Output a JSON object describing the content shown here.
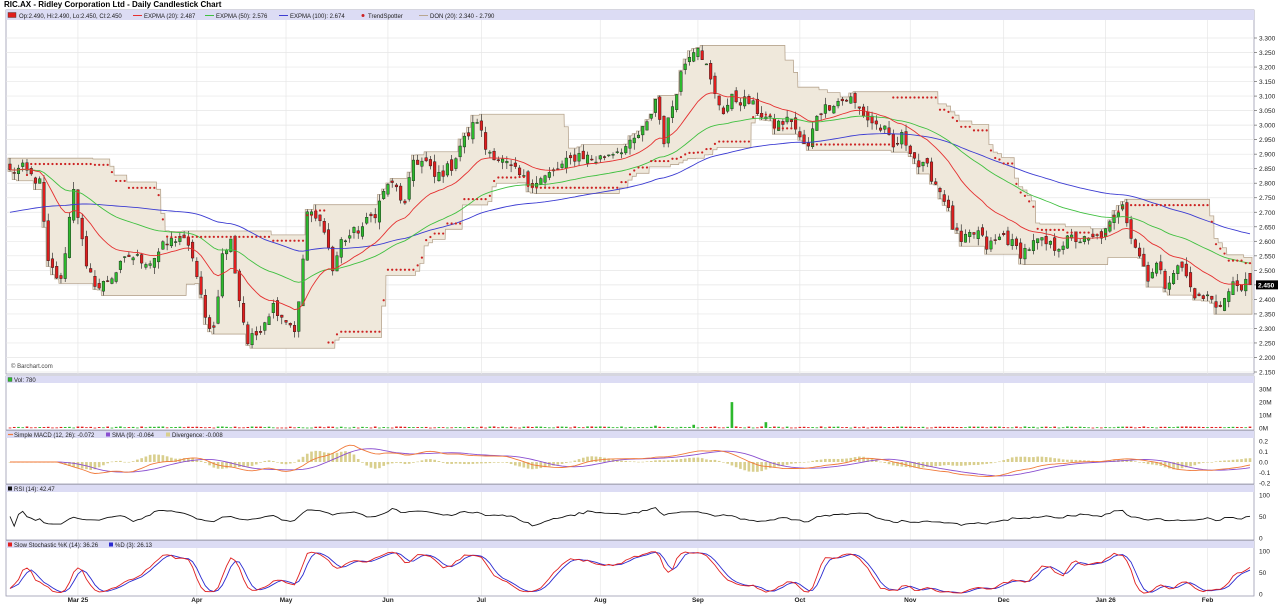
{
  "title": "RIC.AX - Ridley Corporation Ltd - Daily Candlestick Chart",
  "colors": {
    "up": "#2db92d",
    "down": "#e01e1e",
    "ema20": "#e53030",
    "ema50": "#40c040",
    "ema100": "#3c3cd2",
    "trend": "#cc2222",
    "don_fill": "#efe8db",
    "don_line": "#b8a690",
    "header_bg": "#dcdcf4",
    "grid": "#e6e6e6",
    "sma_line": "#8a4fd0",
    "macd_line": "#f07a3a",
    "hist": "#d9cf8e",
    "stoch_k": "#e02020",
    "stoch_d": "#2a2ad0"
  },
  "legend": {
    "ohlc": "Op:2.490, Hi:2.490, Lo:2.450, Cl:2.450",
    "ema20": "EXPMA (20): 2.487",
    "ema50": "EXPMA (50): 2.576",
    "ema100": "EXPMA (100): 2.674",
    "trend": "TrendSpotter",
    "don": "DON (20): 2.340 - 2.790"
  },
  "copyright": "© Barchart.com",
  "last_price": "2.450",
  "panels": {
    "volume": {
      "label": "Vol: 780",
      "ticks": [
        "30M",
        "20M",
        "10M",
        "0M"
      ]
    },
    "macd": {
      "label": "Simple MACD (12, 26): -0.072",
      "sma": "SMA (9): -0.064",
      "div": "Divergence: -0.008",
      "ticks": [
        "0.2",
        "0.1",
        "0.0",
        "-0.1",
        "-0.2"
      ]
    },
    "rsi": {
      "label": "RSI (14): 42.47",
      "ticks": [
        "100",
        "50",
        "0"
      ]
    },
    "stoch": {
      "label": "Slow Stochastic %K (14): 36.26",
      "d": "%D (3): 26.13",
      "ticks": [
        "100",
        "50",
        "0"
      ]
    }
  },
  "chart_data": {
    "type": "candlestick",
    "price_axis": {
      "min": 2.15,
      "max": 3.3,
      "ticks": [
        "3.300",
        "3.250",
        "3.200",
        "3.150",
        "3.100",
        "3.050",
        "3.000",
        "2.950",
        "2.900",
        "2.850",
        "2.800",
        "2.750",
        "2.700",
        "2.650",
        "2.600",
        "2.550",
        "2.500",
        "2.450",
        "2.400",
        "2.350",
        "2.300",
        "2.250",
        "2.200",
        "2.150"
      ]
    },
    "months": [
      "Mar 25",
      "Apr",
      "May",
      "Jun",
      "Jul",
      "Aug",
      "Sep",
      "Oct",
      "Nov",
      "Dec",
      "Jan 26",
      "Feb"
    ],
    "month_index": [
      16,
      44,
      65,
      89,
      111,
      139,
      162,
      186,
      212,
      234,
      258,
      282
    ],
    "anchors": [
      [
        0,
        2.84
      ],
      [
        3,
        2.85
      ],
      [
        7,
        2.8
      ],
      [
        9,
        2.52
      ],
      [
        12,
        2.46
      ],
      [
        15,
        2.79
      ],
      [
        18,
        2.5
      ],
      [
        21,
        2.44
      ],
      [
        24,
        2.48
      ],
      [
        28,
        2.55
      ],
      [
        33,
        2.53
      ],
      [
        36,
        2.58
      ],
      [
        40,
        2.62
      ],
      [
        43,
        2.55
      ],
      [
        46,
        2.33
      ],
      [
        48,
        2.3
      ],
      [
        50,
        2.55
      ],
      [
        52,
        2.6
      ],
      [
        54,
        2.4
      ],
      [
        56,
        2.25
      ],
      [
        58,
        2.28
      ],
      [
        62,
        2.38
      ],
      [
        65,
        2.33
      ],
      [
        67,
        2.3
      ],
      [
        68,
        2.38
      ],
      [
        70,
        2.7
      ],
      [
        74,
        2.65
      ],
      [
        76,
        2.5
      ],
      [
        78,
        2.6
      ],
      [
        80,
        2.62
      ],
      [
        83,
        2.65
      ],
      [
        86,
        2.7
      ],
      [
        89,
        2.8
      ],
      [
        91,
        2.78
      ],
      [
        93,
        2.72
      ],
      [
        95,
        2.88
      ],
      [
        98,
        2.87
      ],
      [
        100,
        2.82
      ],
      [
        104,
        2.86
      ],
      [
        106,
        2.93
      ],
      [
        108,
        2.97
      ],
      [
        110,
        3.02
      ],
      [
        112,
        2.92
      ],
      [
        114,
        2.9
      ],
      [
        118,
        2.85
      ],
      [
        122,
        2.8
      ],
      [
        126,
        2.82
      ],
      [
        130,
        2.86
      ],
      [
        134,
        2.9
      ],
      [
        138,
        2.88
      ],
      [
        142,
        2.91
      ],
      [
        146,
        2.93
      ],
      [
        150,
        3.0
      ],
      [
        152,
        3.09
      ],
      [
        154,
        2.95
      ],
      [
        156,
        3.07
      ],
      [
        158,
        3.18
      ],
      [
        160,
        3.25
      ],
      [
        162,
        3.28
      ],
      [
        164,
        3.2
      ],
      [
        166,
        3.1
      ],
      [
        168,
        3.05
      ],
      [
        170,
        3.09
      ],
      [
        174,
        3.08
      ],
      [
        176,
        3.05
      ],
      [
        180,
        3.0
      ],
      [
        184,
        3.02
      ],
      [
        186,
        2.95
      ],
      [
        188,
        2.92
      ],
      [
        190,
        3.04
      ],
      [
        194,
        3.08
      ],
      [
        198,
        3.09
      ],
      [
        202,
        3.02
      ],
      [
        206,
        2.98
      ],
      [
        208,
        2.92
      ],
      [
        210,
        2.96
      ],
      [
        212,
        2.92
      ],
      [
        214,
        2.86
      ],
      [
        216,
        2.85
      ],
      [
        218,
        2.8
      ],
      [
        220,
        2.75
      ],
      [
        222,
        2.65
      ],
      [
        224,
        2.59
      ],
      [
        226,
        2.62
      ],
      [
        228,
        2.63
      ],
      [
        230,
        2.58
      ],
      [
        234,
        2.62
      ],
      [
        238,
        2.56
      ],
      [
        242,
        2.6
      ],
      [
        246,
        2.58
      ],
      [
        250,
        2.61
      ],
      [
        254,
        2.6
      ],
      [
        258,
        2.63
      ],
      [
        260,
        2.68
      ],
      [
        262,
        2.74
      ],
      [
        264,
        2.62
      ],
      [
        266,
        2.55
      ],
      [
        268,
        2.48
      ],
      [
        270,
        2.52
      ],
      [
        272,
        2.45
      ],
      [
        274,
        2.5
      ],
      [
        276,
        2.51
      ],
      [
        278,
        2.44
      ],
      [
        280,
        2.4
      ],
      [
        282,
        2.41
      ],
      [
        284,
        2.38
      ],
      [
        286,
        2.4
      ],
      [
        288,
        2.45
      ]
    ],
    "series": [
      {
        "name": "EXPMA (20)",
        "last": 2.487
      },
      {
        "name": "EXPMA (50)",
        "last": 2.576
      },
      {
        "name": "EXPMA (100)",
        "last": 2.674
      },
      {
        "name": "DON (20)",
        "low": 2.34,
        "high": 2.79
      }
    ]
  }
}
